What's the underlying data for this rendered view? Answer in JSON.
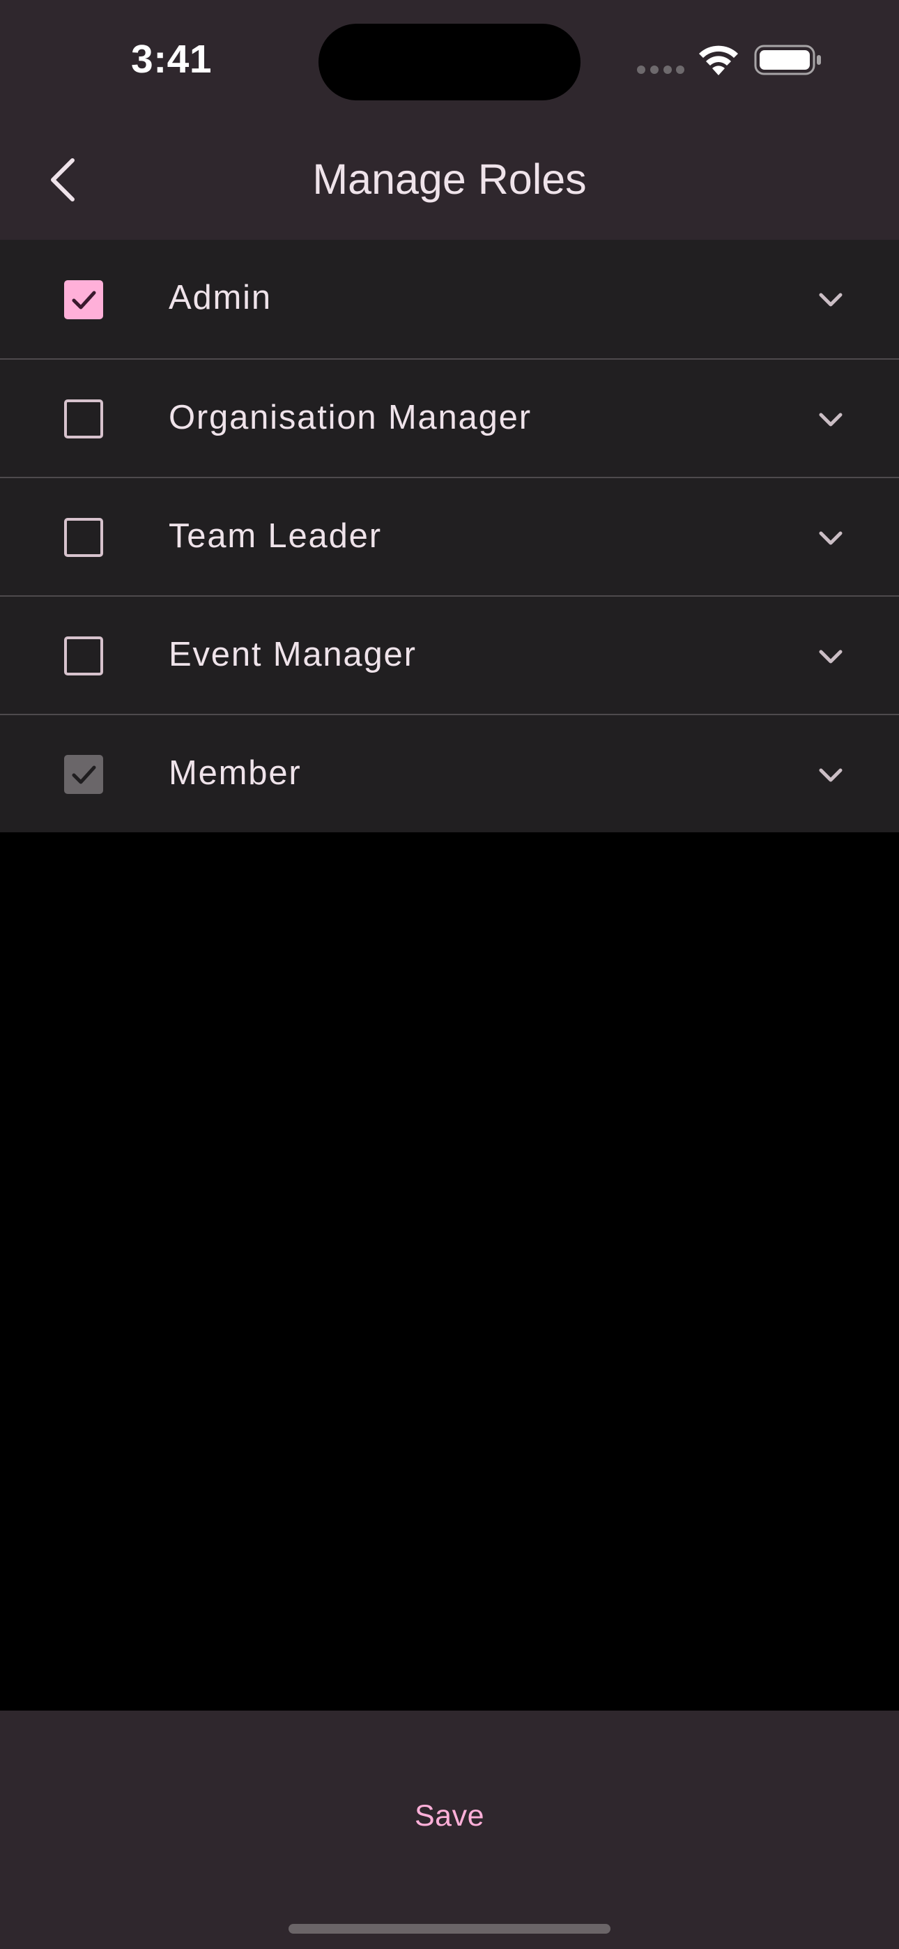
{
  "status_bar": {
    "time": "3:41",
    "icons": [
      "cellular-signal-icon",
      "wifi-icon",
      "battery-icon"
    ]
  },
  "header": {
    "back_icon": "chevron-left-icon",
    "title": "Manage Roles"
  },
  "roles": [
    {
      "label": "Admin",
      "checked": true,
      "disabled": false
    },
    {
      "label": "Organisation Manager",
      "checked": false,
      "disabled": false
    },
    {
      "label": "Team Leader",
      "checked": false,
      "disabled": false
    },
    {
      "label": "Event Manager",
      "checked": false,
      "disabled": false
    },
    {
      "label": "Member",
      "checked": true,
      "disabled": true
    }
  ],
  "footer": {
    "save_label": "Save"
  },
  "colors": {
    "accent": "#ffb0d9",
    "bar_background": "#2f272d",
    "row_background": "#211f21",
    "text": "#efe3ea"
  }
}
